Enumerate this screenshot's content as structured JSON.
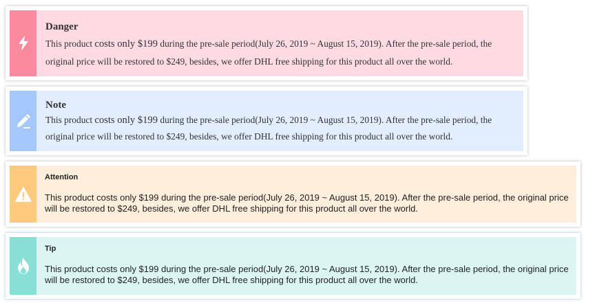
{
  "notes": [
    {
      "title": "Danger",
      "icon": "lightning-icon",
      "strip_color": "#fb8a9e",
      "bg_color": "#fedbe2",
      "text_before": "This product ",
      "text_big": "costs only $199",
      "text_after": " during the pre-sale period(July 26, 2019 ~ August 15, 2019). After the pre-sale period, the original price will be restored to $249, besides, we offer DHL free shipping for this product all over the world."
    },
    {
      "title": "Note",
      "icon": "pencil-icon",
      "strip_color": "#a4c7fd",
      "bg_color": "#e2eefe",
      "text_before": "This product ",
      "text_big": "costs only $199",
      "text_after": " during the pre-sale period(July 26, 2019 ~ August 15, 2019). After the pre-sale period, the original price will be restored to $249, besides, we offer DHL free shipping for this product all over the world."
    },
    {
      "title": "Attention",
      "icon": "warning-icon",
      "strip_color": "#fecb7e",
      "bg_color": "#feeedb",
      "text": "This product costs only $199 during the pre-sale period(July 26, 2019 ~ August 15, 2019). After the pre-sale period, the original price will be restored to $249, besides, we offer DHL free shipping for this product all over the world."
    },
    {
      "title": "Tip",
      "icon": "flame-icon",
      "strip_color": "#87dfd5",
      "bg_color": "#dbf5f3",
      "text": "This product costs only $199 during the pre-sale period(July 26, 2019 ~ August 15, 2019). After the pre-sale period, the original price will be restored to $249, besides, we offer DHL free shipping for this product all over the world."
    }
  ]
}
